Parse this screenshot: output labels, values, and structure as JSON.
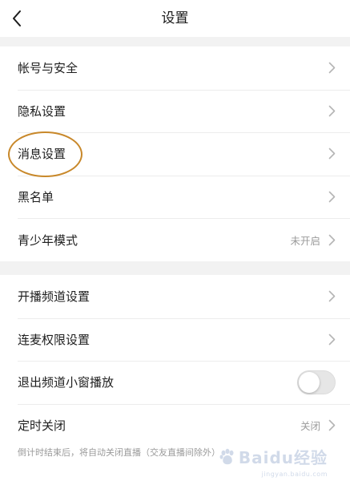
{
  "header": {
    "title": "设置"
  },
  "section1": {
    "items": [
      {
        "label": "帐号与安全"
      },
      {
        "label": "隐私设置"
      },
      {
        "label": "消息设置"
      },
      {
        "label": "黑名单"
      },
      {
        "label": "青少年模式",
        "value": "未开启"
      }
    ]
  },
  "section2": {
    "items": [
      {
        "label": "开播频道设置"
      },
      {
        "label": "连麦权限设置"
      },
      {
        "label": "退出频道小窗播放",
        "toggle_on": false
      },
      {
        "label": "定时关闭",
        "value": "关闭"
      }
    ],
    "hint": "倒计时结束后，将自动关闭直播（交友直播间除外）"
  },
  "watermark": {
    "text": "Baidu经验",
    "sub": "jingyan.baidu.com"
  },
  "colors": {
    "annotation": "#c8882a",
    "toggle_off": "#e6e6e6",
    "secondary_text": "#9a9a9a"
  }
}
